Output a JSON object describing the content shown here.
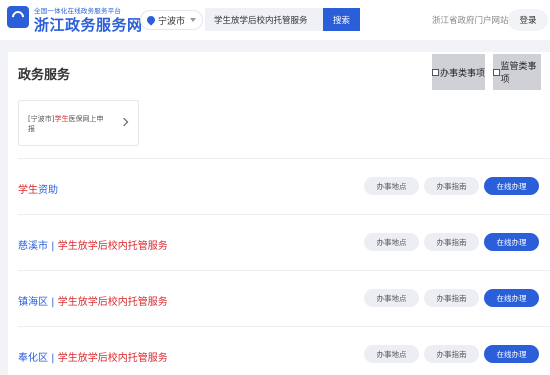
{
  "header": {
    "logo_subtitle": "全国一体化在线政务服务平台",
    "logo_title": "浙江政务服务网",
    "city": "宁波市",
    "search_value": "学生放学后校内托管服务",
    "search_button": "搜索",
    "portal_link": "浙江省政府门户网站",
    "login": "登录"
  },
  "panel": {
    "title": "政务服务",
    "filters": {
      "handle": "办事类事项",
      "supervise": "监管类事项"
    },
    "card": {
      "prefix": "[宁波市]",
      "highlight": "学生",
      "suffix": "医保网上申报"
    },
    "items": [
      {
        "prefix": "",
        "highlight": "学生",
        "suffix": "资助"
      },
      {
        "prefix": "慈溪市 | ",
        "highlight": "学生放学后校内托管服务",
        "suffix": ""
      },
      {
        "prefix": "镇海区 | ",
        "highlight": "学生放学后校内托管服务",
        "suffix": ""
      },
      {
        "prefix": "奉化区 | ",
        "highlight": "学生放学后校内托管服务",
        "suffix": ""
      }
    ],
    "actions": {
      "location": "办事地点",
      "guide": "办事指南",
      "online": "在线办理"
    }
  },
  "colors": {
    "brand_blue": "#2b5fd9",
    "highlight_red": "#d9292d"
  }
}
